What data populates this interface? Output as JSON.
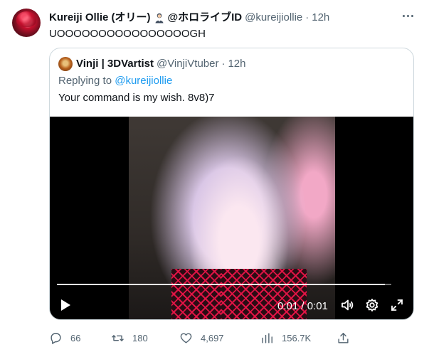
{
  "author": {
    "display_name": "Kureiji Ollie (オリー)",
    "affiliation": "@ホロライブID",
    "handle": "@kureijiollie",
    "time": "12h"
  },
  "tweet_text": "UOOOOOOOOOOOOOOOOGH",
  "quoted": {
    "display_name": "Vinji | 3DVartist",
    "handle": "@VinjiVtuber",
    "time": "12h",
    "replying_prefix": "Replying to ",
    "replying_mention": "@kureijiollie",
    "text": "Your command is my wish. 8v8)7",
    "video": {
      "timecode": "0:01 / 0:01",
      "progress_fraction": 0.98
    }
  },
  "actions": {
    "replies": "66",
    "retweets": "180",
    "likes": "4,697",
    "views": "156.7K"
  },
  "colors": {
    "accent": "#1d9bf0",
    "secondary_text": "#536471",
    "border": "#cfd9de"
  },
  "icons": [
    "more-icon",
    "play-icon",
    "volume-icon",
    "settings-icon",
    "fullscreen-icon",
    "reply-icon",
    "retweet-icon",
    "like-icon",
    "views-icon",
    "share-icon"
  ]
}
